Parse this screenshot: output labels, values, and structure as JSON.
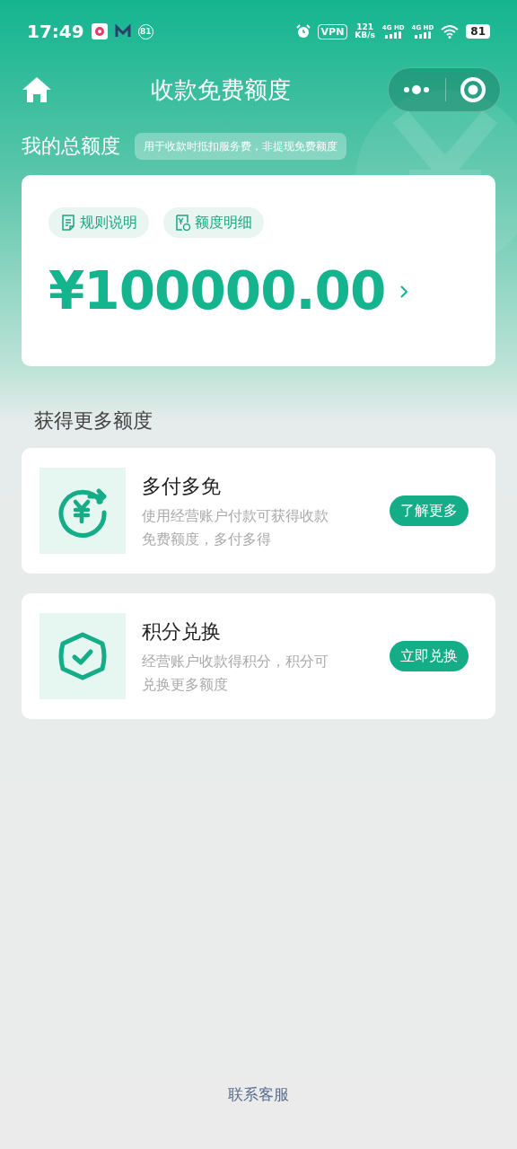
{
  "status_bar": {
    "time": "17:49",
    "notification_badge": "81",
    "vpn": "VPN",
    "speed": "121",
    "speed_unit": "KB/s",
    "networks": [
      "4G HD",
      "4G HD"
    ],
    "battery": "81"
  },
  "nav": {
    "title": "收款免费额度"
  },
  "total": {
    "label": "我的总额度",
    "hint": "用于收款时抵扣服务费，非提现免费额度",
    "links": [
      {
        "kind": "rules",
        "label": "规则说明"
      },
      {
        "kind": "detail",
        "label": "额度明细"
      }
    ],
    "amount": "¥100000.00"
  },
  "more": {
    "title": "获得更多额度",
    "offers": [
      {
        "kind": "pay",
        "title": "多付多免",
        "desc": "使用经营账户付款可获得收款免费额度，多付多得",
        "button": "了解更多"
      },
      {
        "kind": "points",
        "title": "积分兑换",
        "desc": "经营账户收款得积分，积分可兑换更多额度",
        "button": "立即兑换"
      }
    ]
  },
  "footer": {
    "link": "联系客服"
  }
}
